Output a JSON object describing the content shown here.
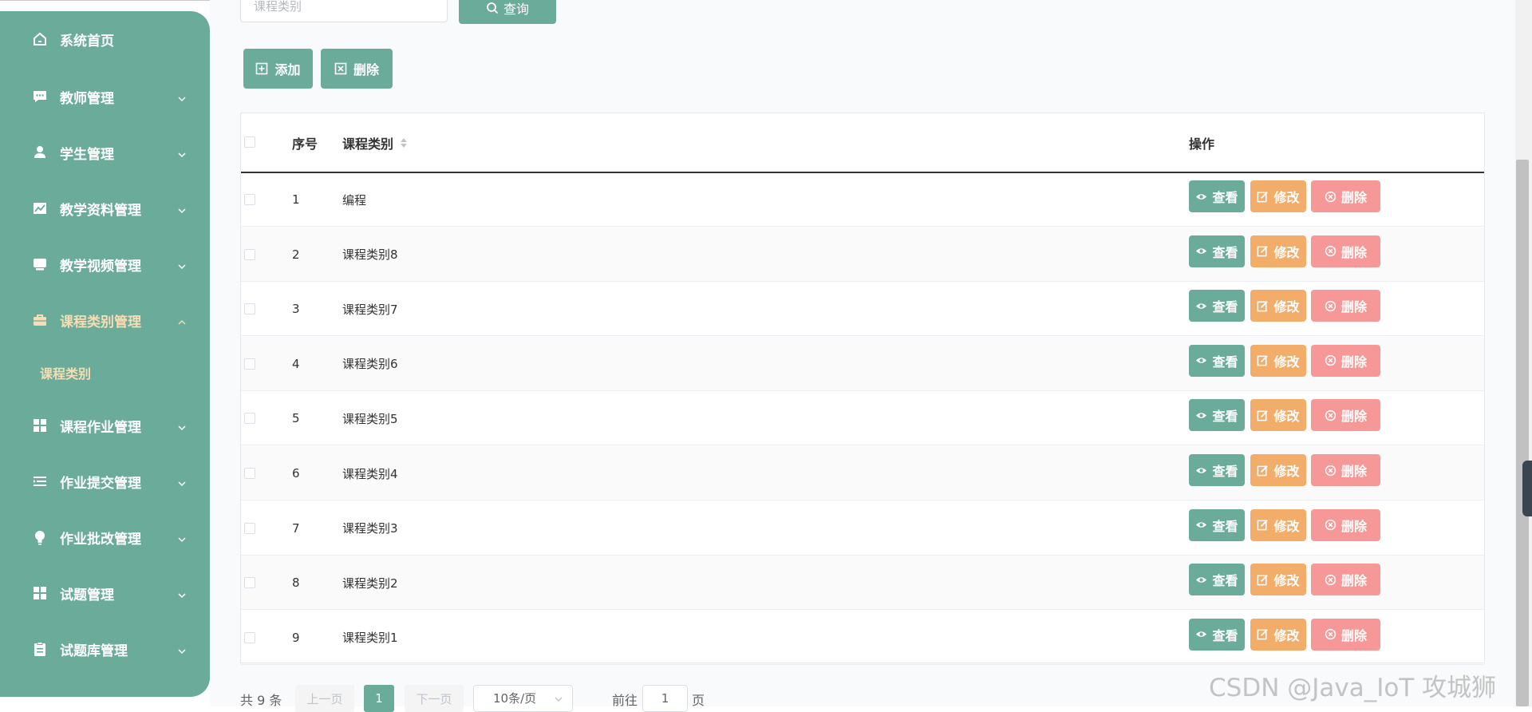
{
  "colors": {
    "primary": "#6aab99",
    "warning": "#f3ad6a",
    "danger": "#f69898",
    "active_text": "#f7ddb3"
  },
  "sidebar": {
    "items": [
      {
        "label": "系统首页",
        "icon": "home-icon",
        "has_chevron": false
      },
      {
        "label": "教师管理",
        "icon": "chat-icon",
        "has_chevron": true
      },
      {
        "label": "学生管理",
        "icon": "user-icon",
        "has_chevron": true
      },
      {
        "label": "教学资料管理",
        "icon": "chart-icon",
        "has_chevron": true
      },
      {
        "label": "教学视频管理",
        "icon": "monitor-icon",
        "has_chevron": true
      },
      {
        "label": "课程类别管理",
        "icon": "briefcase-icon",
        "has_chevron": true,
        "expanded": true
      },
      {
        "label": "课程作业管理",
        "icon": "grid-icon",
        "has_chevron": true
      },
      {
        "label": "作业提交管理",
        "icon": "list-icon",
        "has_chevron": true
      },
      {
        "label": "作业批改管理",
        "icon": "bulb-icon",
        "has_chevron": true
      },
      {
        "label": "试题管理",
        "icon": "grid-icon",
        "has_chevron": true
      },
      {
        "label": "试题库管理",
        "icon": "clipboard-icon",
        "has_chevron": true
      }
    ],
    "subitem": "课程类别"
  },
  "search": {
    "placeholder": "课程类别",
    "button": "查询"
  },
  "toolbar": {
    "add": "添加",
    "delete": "删除"
  },
  "table": {
    "columns": [
      "序号",
      "课程类别",
      "操作"
    ],
    "rows": [
      {
        "no": "1",
        "category": "编程"
      },
      {
        "no": "2",
        "category": "课程类别8"
      },
      {
        "no": "3",
        "category": "课程类别7"
      },
      {
        "no": "4",
        "category": "课程类别6"
      },
      {
        "no": "5",
        "category": "课程类别5"
      },
      {
        "no": "6",
        "category": "课程类别4"
      },
      {
        "no": "7",
        "category": "课程类别3"
      },
      {
        "no": "8",
        "category": "课程类别2"
      },
      {
        "no": "9",
        "category": "课程类别1"
      }
    ],
    "actions": {
      "view": "查看",
      "edit": "修改",
      "delete": "删除"
    }
  },
  "pagination": {
    "total": "共 9 条",
    "prev": "上一页",
    "page": "1",
    "next": "下一页",
    "page_size": "10条/页",
    "goto_prefix": "前往",
    "goto_value": "1",
    "goto_suffix": "页"
  },
  "watermark": "CSDN @Java_IoT 攻城狮"
}
